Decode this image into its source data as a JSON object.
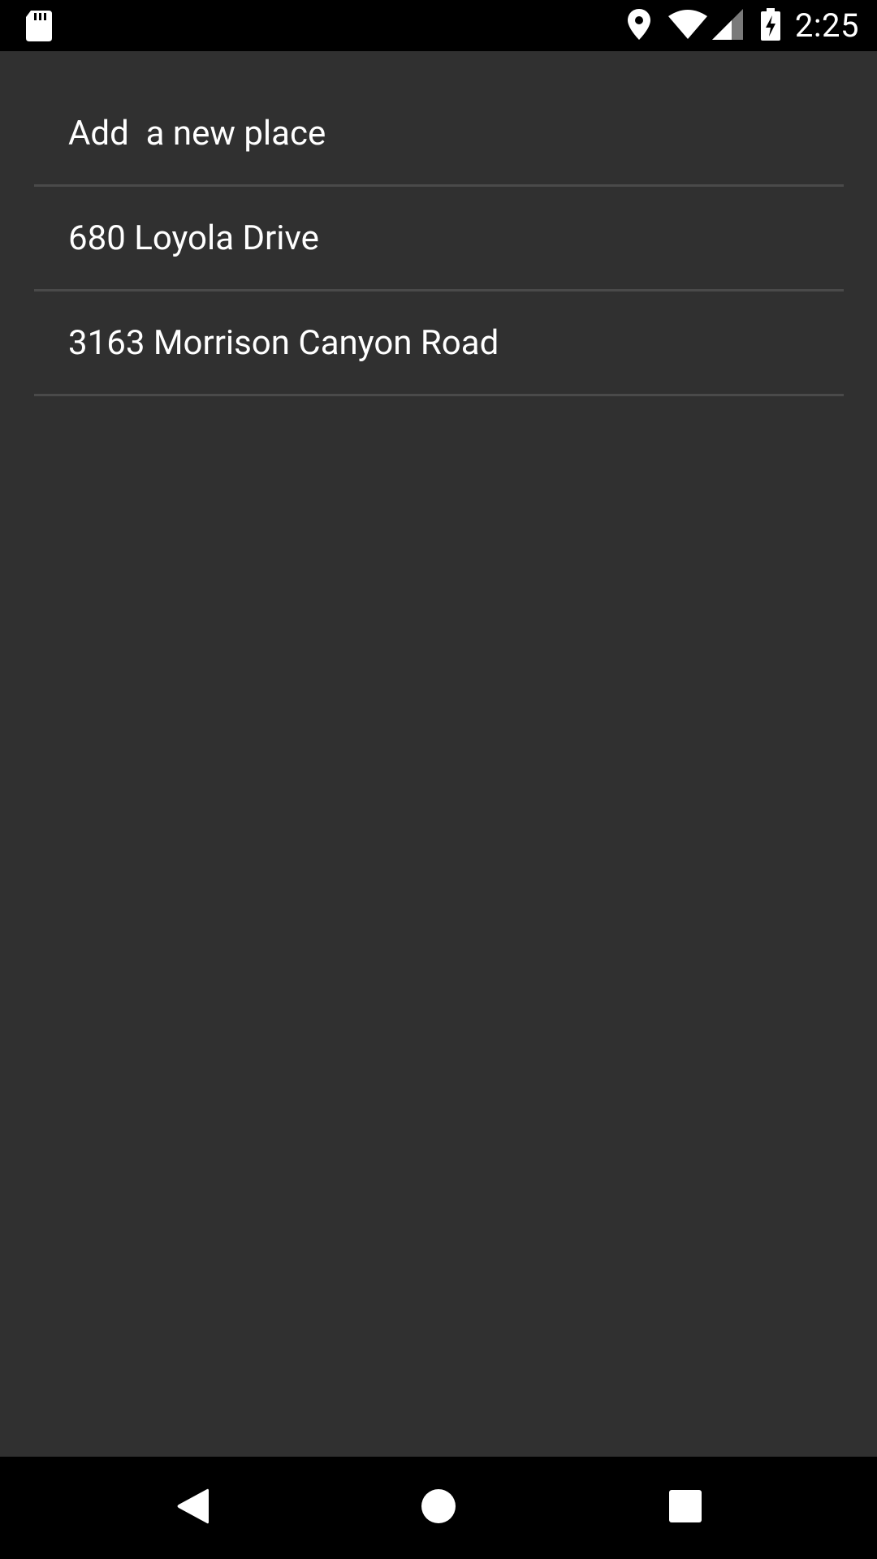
{
  "status_bar": {
    "time": "2:25",
    "icons": [
      "sd-card-icon",
      "location-icon",
      "wifi-icon",
      "signal-icon",
      "battery-charging-icon"
    ]
  },
  "places": {
    "items": [
      {
        "label": "Add  a new place"
      },
      {
        "label": "680 Loyola Drive"
      },
      {
        "label": "3163 Morrison Canyon Road"
      }
    ]
  },
  "nav_bar": {
    "buttons": [
      "back-icon",
      "home-icon",
      "recents-icon"
    ]
  },
  "colors": {
    "background": "#303030",
    "divider": "#4a4a4a",
    "text": "#ffffff",
    "system_bars": "#000000"
  }
}
